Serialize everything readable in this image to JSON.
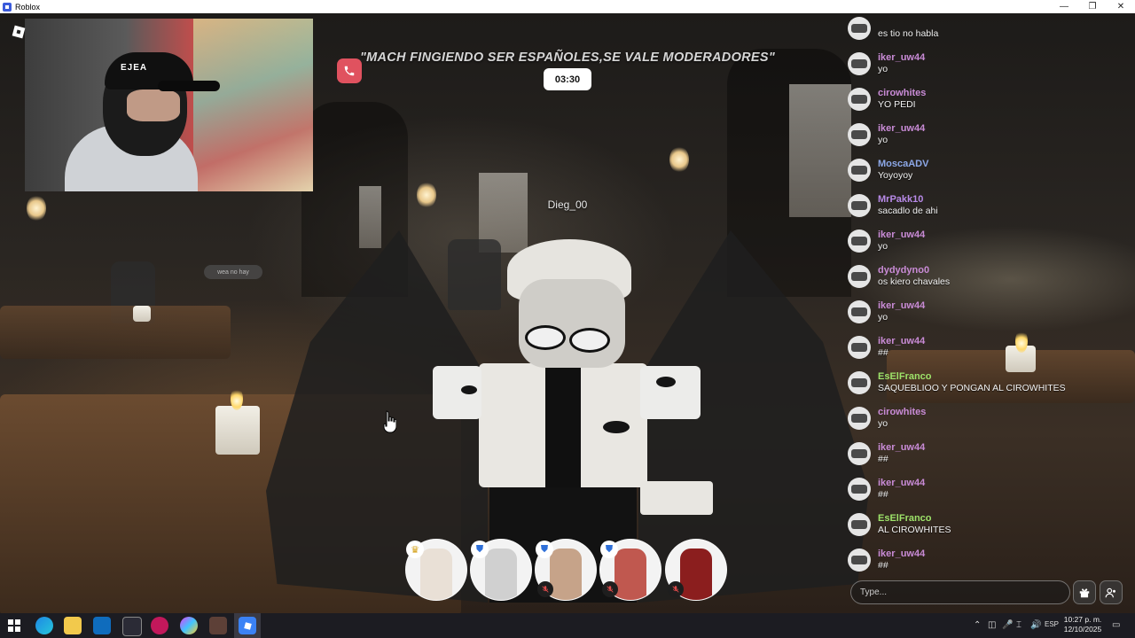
{
  "window": {
    "title": "Roblox"
  },
  "banner": {
    "text": "\"MACH FINGIENDO SER ESPAÑOLES,SE VALE MODERADORES\"",
    "timer": "03:30"
  },
  "player": {
    "name": "Dieg_00"
  },
  "chat": {
    "messages": [
      {
        "user": "",
        "text": "es tio no habla",
        "color": "#d8a4ff"
      },
      {
        "user": "iker_uw44",
        "text": "yo",
        "color": "#c98bd6"
      },
      {
        "user": "cirowhites",
        "text": "YO PEDI",
        "color": "#c98bd6"
      },
      {
        "user": "iker_uw44",
        "text": "yo",
        "color": "#c98bd6"
      },
      {
        "user": "MoscaADV",
        "text": "Yoyoyoy",
        "color": "#8da8e8"
      },
      {
        "user": "MrPakk10",
        "text": "sacadlo de ahi",
        "color": "#b88ae8"
      },
      {
        "user": "iker_uw44",
        "text": "yo",
        "color": "#c98bd6"
      },
      {
        "user": "dydydyno0",
        "text": "os kiero chavales",
        "color": "#c98bd6"
      },
      {
        "user": "iker_uw44",
        "text": "yo",
        "color": "#c98bd6"
      },
      {
        "user": "iker_uw44",
        "text": "##",
        "color": "#c98bd6"
      },
      {
        "user": "EsElFranco",
        "text": "SAQUEBLIOO Y PONGAN AL CIROWHITES",
        "color": "#9ee36a"
      },
      {
        "user": "cirowhites",
        "text": "yo",
        "color": "#c98bd6"
      },
      {
        "user": "iker_uw44",
        "text": "##",
        "color": "#c98bd6"
      },
      {
        "user": "iker_uw44",
        "text": "##",
        "color": "#c98bd6"
      },
      {
        "user": "EsElFranco",
        "text": "AL CIROWHITES",
        "color": "#9ee36a"
      },
      {
        "user": "iker_uw44",
        "text": "##",
        "color": "#c98bd6"
      }
    ],
    "input_placeholder": "Type..."
  },
  "participants": [
    {
      "badge": "crown",
      "muted": false,
      "color": "#e9e0d6"
    },
    {
      "badge": "shield",
      "muted": false,
      "color": "#d0d0d0"
    },
    {
      "badge": "shield",
      "muted": true,
      "color": "#c6a389"
    },
    {
      "badge": "shield",
      "muted": true,
      "color": "#c0584f"
    },
    {
      "badge": "",
      "muted": true,
      "color": "#8b1e1e"
    }
  ],
  "webcam": {
    "cap_text": "EJEA"
  },
  "bg_bubble": {
    "text": "wea no hay"
  },
  "taskbar": {
    "lang": "ESP",
    "time": "10:27 p. m.",
    "date": "12/10/2025"
  }
}
